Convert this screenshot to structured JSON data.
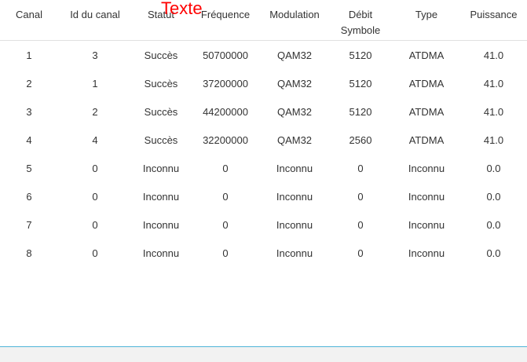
{
  "overlay": {
    "label": "Texte"
  },
  "table": {
    "headers": [
      {
        "line1": "Canal",
        "line2": ""
      },
      {
        "line1": "Id du canal",
        "line2": ""
      },
      {
        "line1": "Statut",
        "line2": ""
      },
      {
        "line1": "Fréquence",
        "line2": ""
      },
      {
        "line1": "Modulation",
        "line2": ""
      },
      {
        "line1": "Débit",
        "line2": "Symbole"
      },
      {
        "line1": "Type",
        "line2": ""
      },
      {
        "line1": "Puissance",
        "line2": ""
      }
    ],
    "rows": [
      [
        "1",
        "3",
        "Succès",
        "50700000",
        "QAM32",
        "5120",
        "ATDMA",
        "41.0"
      ],
      [
        "2",
        "1",
        "Succès",
        "37200000",
        "QAM32",
        "5120",
        "ATDMA",
        "41.0"
      ],
      [
        "3",
        "2",
        "Succès",
        "44200000",
        "QAM32",
        "5120",
        "ATDMA",
        "41.0"
      ],
      [
        "4",
        "4",
        "Succès",
        "32200000",
        "QAM32",
        "2560",
        "ATDMA",
        "41.0"
      ],
      [
        "5",
        "0",
        "Inconnu",
        "0",
        "Inconnu",
        "0",
        "Inconnu",
        "0.0"
      ],
      [
        "6",
        "0",
        "Inconnu",
        "0",
        "Inconnu",
        "0",
        "Inconnu",
        "0.0"
      ],
      [
        "7",
        "0",
        "Inconnu",
        "0",
        "Inconnu",
        "0",
        "Inconnu",
        "0.0"
      ],
      [
        "8",
        "0",
        "Inconnu",
        "0",
        "Inconnu",
        "0",
        "Inconnu",
        "0.0"
      ]
    ]
  }
}
